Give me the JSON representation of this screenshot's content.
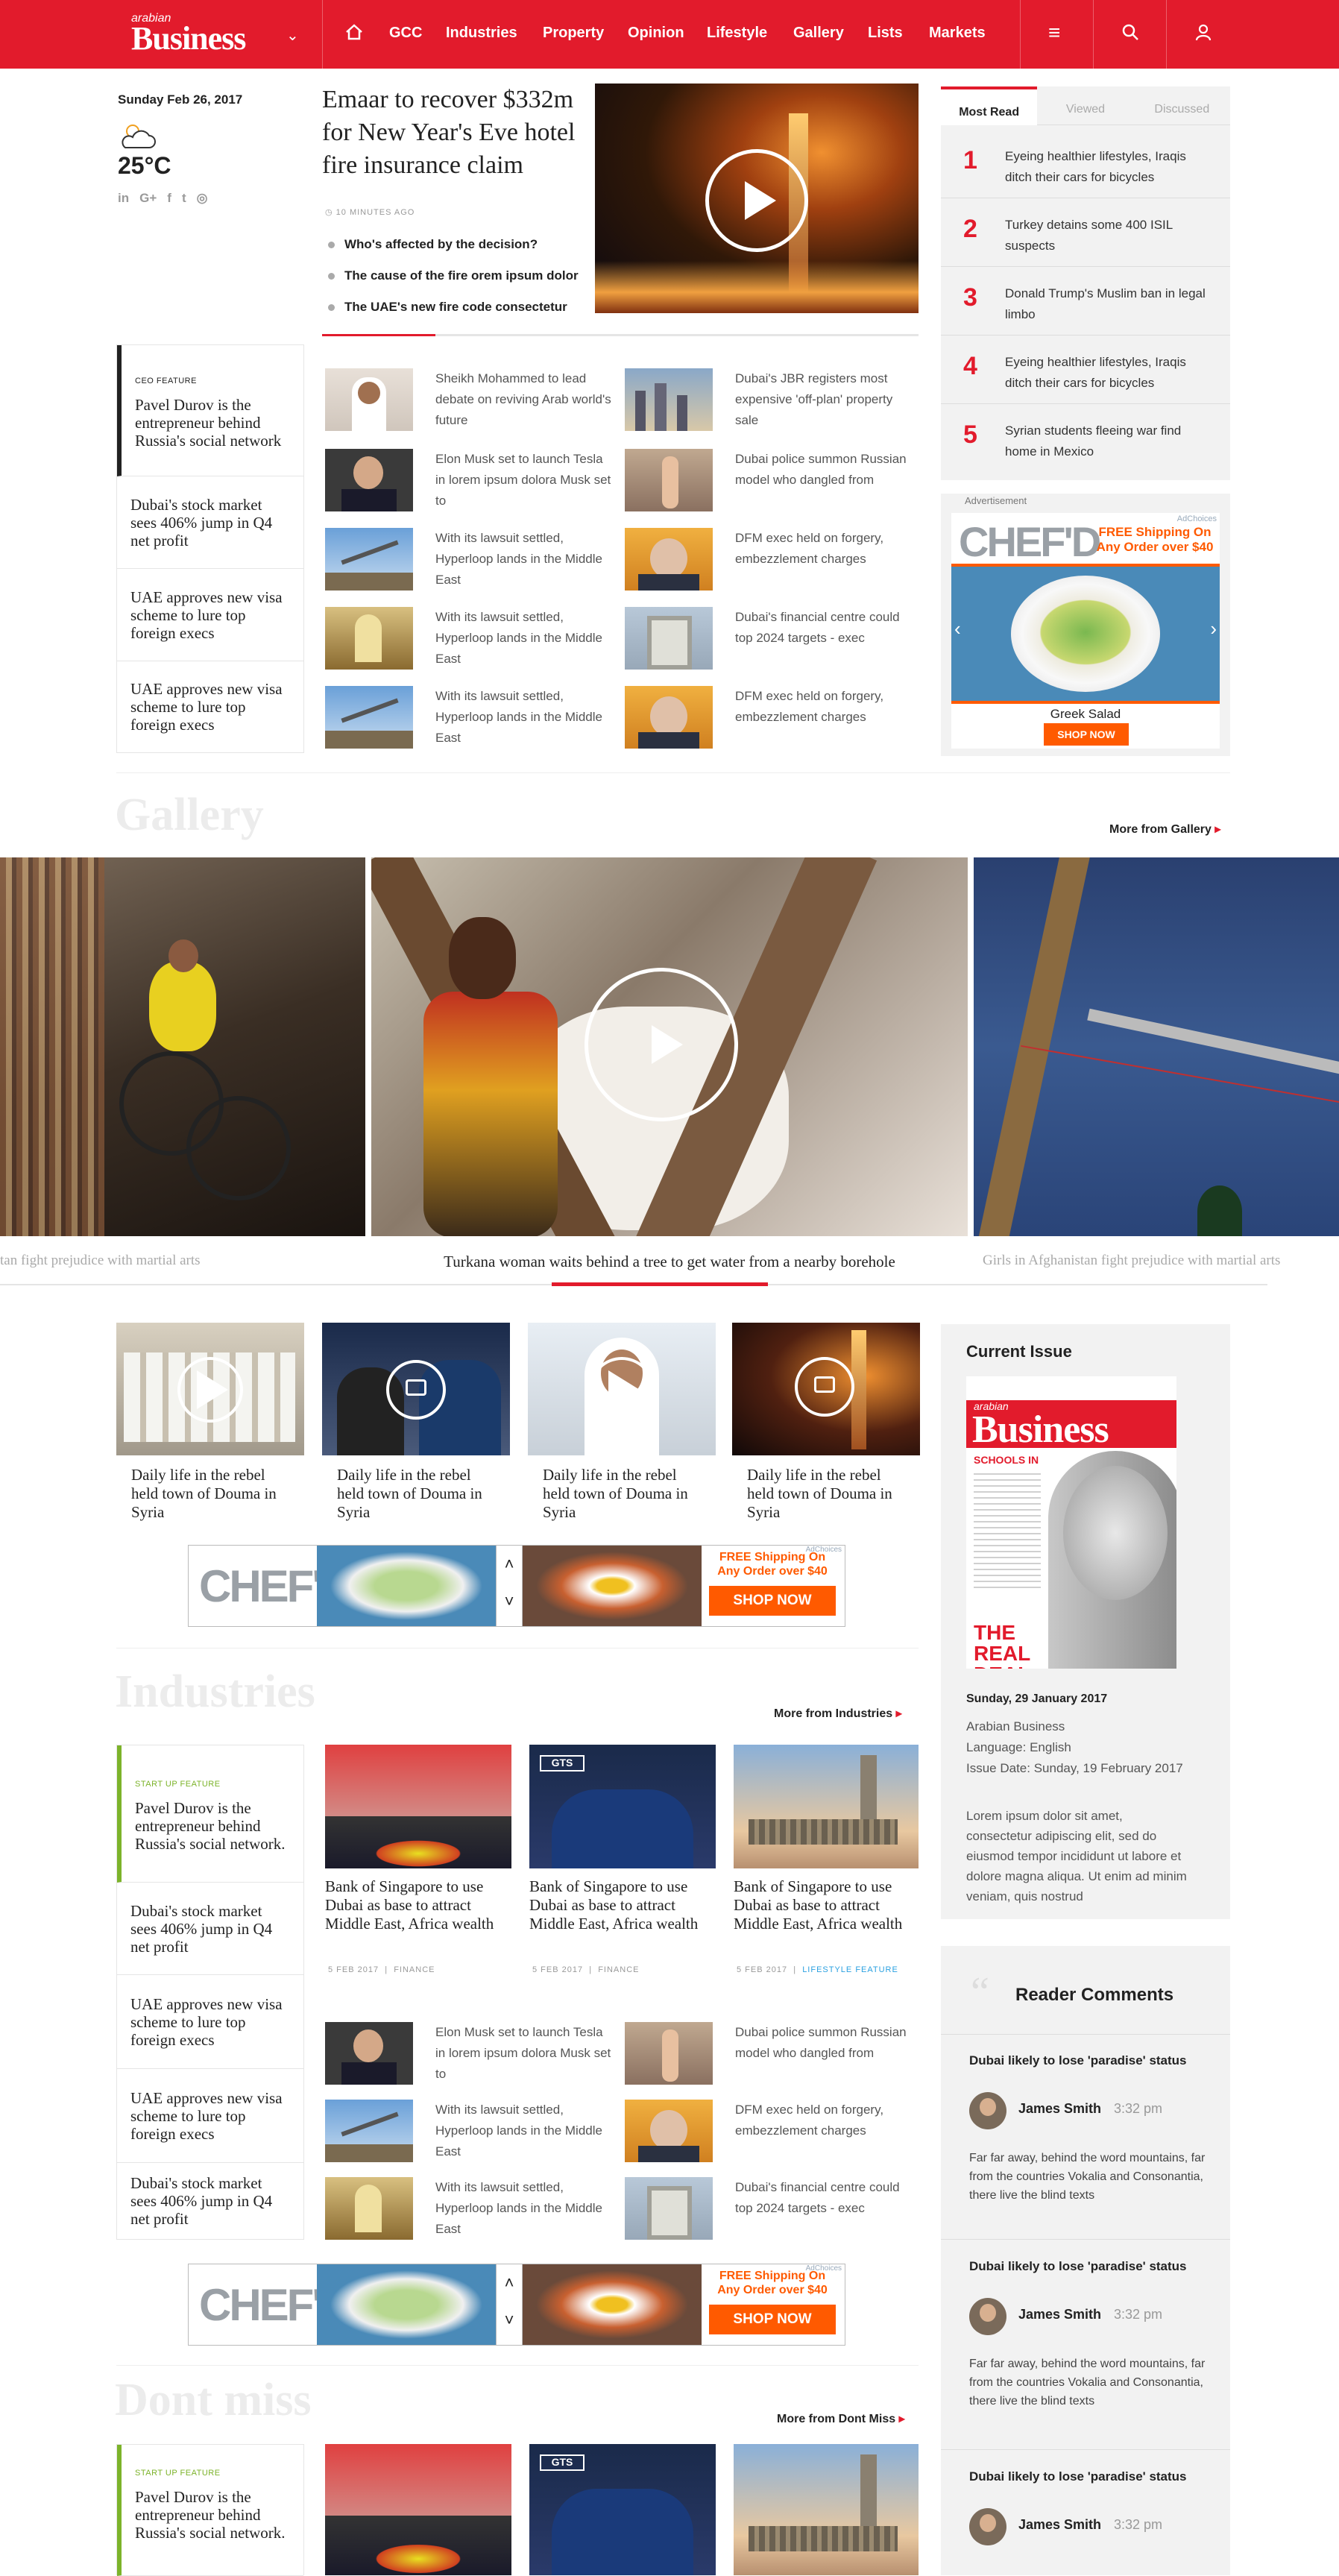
{
  "header": {
    "logo_small": "arabian",
    "logo_big": "Business",
    "nav": [
      "GCC",
      "Industries",
      "Property",
      "Opinion",
      "Lifestyle",
      "Gallery",
      "Lists",
      "Markets"
    ],
    "accent": "#e21b2c"
  },
  "weather": {
    "date": "Sunday Feb 26, 2017",
    "temp": "25°C",
    "social": [
      "in",
      "G+",
      "f",
      "t",
      "◎"
    ]
  },
  "lead": {
    "headline": "Emaar to recover $332m for New Year's Eve hotel fire insurance claim",
    "time": "10 MINUTES AGO",
    "bullets": [
      "Who's affected by the decision?",
      "The cause of the fire orem ipsum dolor",
      "The UAE's new fire code consectetur"
    ]
  },
  "left_top": [
    {
      "tag": "CEO FEATURE",
      "title": "Pavel Durov is the entrepreneur behind Russia's social network"
    },
    {
      "title": "Dubai's stock market sees 406% jump in Q4 net profit"
    },
    {
      "title": "UAE approves new visa scheme to lure top foreign execs"
    },
    {
      "title": "UAE approves new visa scheme to lure top foreign execs"
    }
  ],
  "news_left": [
    "Sheikh Mohammed to lead debate on reviving Arab world's future",
    "Elon Musk set to launch Tesla in lorem ipsum dolora Musk set to",
    "With its lawsuit settled, Hyperloop lands in the Middle East",
    "With its lawsuit settled, Hyperloop lands in the Middle East",
    "With its lawsuit settled, Hyperloop lands in the Middle East"
  ],
  "news_right": [
    "Dubai's JBR registers most expensive 'off-plan' property sale",
    "Dubai police summon Russian model who dangled from",
    "DFM exec held on forgery, embezzlement charges",
    "Dubai's financial centre could top 2024 targets - exec",
    "DFM exec held on forgery, embezzlement charges"
  ],
  "most_read": {
    "tabs": [
      "Most Read",
      "Viewed",
      "Discussed"
    ],
    "items": [
      {
        "n": "1",
        "t": "Eyeing healthier lifestyles, Iraqis ditch their cars for bicycles"
      },
      {
        "n": "2",
        "t": "Turkey detains some 400 ISIL suspects"
      },
      {
        "n": "3",
        "t": "Donald Trump's Muslim ban in legal limbo"
      },
      {
        "n": "4",
        "t": "Eyeing healthier lifestyles, Iraqis ditch their cars for bicycles"
      },
      {
        "n": "5",
        "t": "Syrian students fleeing war find home in Mexico"
      }
    ]
  },
  "ad": {
    "label": "Advertisement",
    "choices": "AdChoices",
    "brand": "CHEF'D",
    "promo1": "FREE Shipping On",
    "promo2": "Any Order over $40",
    "dish": "Greek Salad",
    "cta": "SHOP NOW"
  },
  "gallery": {
    "title": "Gallery",
    "more": "More from Gallery",
    "cap_left": "tan fight prejudice with martial arts",
    "cap_main": "Turkana woman waits behind a tree to get water from a nearby borehole",
    "cap_right": "Girls in Afghanistan fight prejudice with martial arts"
  },
  "gallery_cards": [
    "Daily life in the rebel held town of Douma in Syria",
    "Daily life in the rebel held town of Douma in Syria",
    "Daily life in the rebel held town of Douma in Syria",
    "Daily life in the rebel held town of Douma in Syria"
  ],
  "industries": {
    "title": "Industries",
    "more": "More from Industries",
    "left": [
      {
        "tag": "START UP FEATURE",
        "title": "Pavel Durov is the entrepreneur behind Russia's social network."
      },
      {
        "title": "Dubai's stock market sees 406% jump in Q4 net profit"
      },
      {
        "title": "UAE approves new visa scheme to lure top foreign execs"
      },
      {
        "title": "UAE approves new visa scheme to lure top foreign execs"
      },
      {
        "title": "Dubai's stock market sees 406% jump in Q4 net profit"
      }
    ],
    "cards": [
      {
        "cap": "Bank of Singapore to use Dubai as base to attract Middle East, Africa wealth",
        "date": "5 FEB 2017",
        "cat": "FINANCE"
      },
      {
        "cap": "Bank of Singapore to use Dubai as base to attract Middle East, Africa wealth",
        "date": "5 FEB 2017",
        "cat": "FINANCE"
      },
      {
        "cap": "Bank of Singapore to use Dubai as base to attract Middle East, Africa wealth",
        "date": "5 FEB 2017",
        "cat": "LIFESTYLE FEATURE"
      }
    ],
    "news_left": [
      "Elon Musk set to launch Tesla in lorem ipsum dolora Musk set to",
      "With its lawsuit settled, Hyperloop lands in the Middle East",
      "With its lawsuit settled, Hyperloop lands in the Middle East"
    ],
    "news_right": [
      "Dubai police summon Russian model who dangled from",
      "DFM exec held on forgery, embezzlement charges",
      "Dubai's financial centre could top 2024 targets - exec"
    ]
  },
  "dontmiss": {
    "title": "Dont miss",
    "more": "More from Dont Miss",
    "tag": "START UP FEATURE",
    "title1": "Pavel Durov is the entrepreneur behind Russia's social network."
  },
  "current_issue": {
    "title": "Current Issue",
    "cover_small": "arabian",
    "cover_big": "Business",
    "cover_strap": "THE REAL DEAL",
    "cover_side": "SCHOOLS IN",
    "date": "Sunday, 29 January 2017",
    "pub": "Arabian Business",
    "lang": "Language: English",
    "issue": "Issue Date: Sunday, 19 February 2017",
    "desc": "Lorem ipsum dolor sit amet, consectetur adipiscing elit, sed do eiusmod tempor incididunt ut labore et dolore magna aliqua. Ut enim ad minim veniam, quis nostrud"
  },
  "comments": {
    "title": "Reader Comments",
    "items": [
      {
        "h": "Dubai likely to lose 'paradise' status",
        "name": "James Smith",
        "time": "3:32 pm",
        "body": "Far far away, behind the word mountains, far from the countries Vokalia and Consonantia, there live the blind texts"
      },
      {
        "h": "Dubai likely to lose 'paradise' status",
        "name": "James Smith",
        "time": "3:32 pm",
        "body": "Far far away, behind the word mountains, far from the countries Vokalia and Consonantia, there live the blind texts"
      },
      {
        "h": "Dubai likely to lose 'paradise' status",
        "name": "James Smith",
        "time": "3:32 pm",
        "body": ""
      }
    ]
  }
}
